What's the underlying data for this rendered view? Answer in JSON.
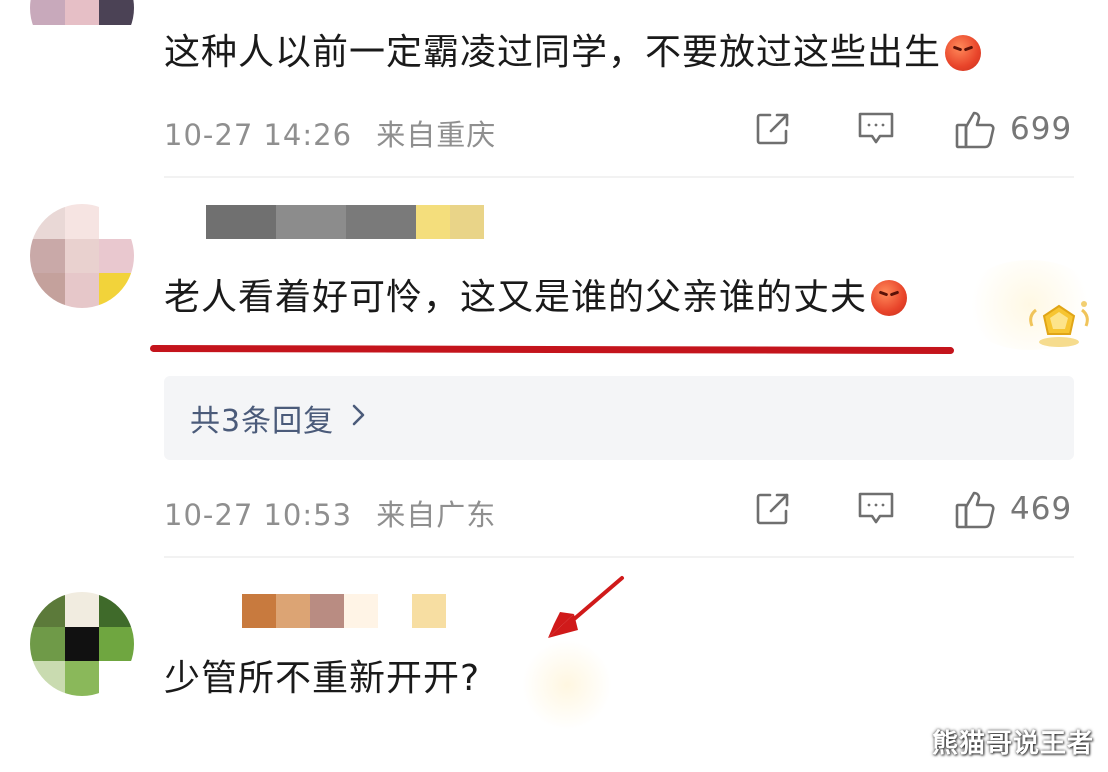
{
  "comments": [
    {
      "text": "这种人以前一定霸凌过同学，不要放过这些出生",
      "emoji": "angry-face-emoji",
      "date": "10-27 14:26",
      "location": "来自重庆",
      "likes": "699"
    },
    {
      "text": "老人看着好可怜，这又是谁的父亲谁的丈夫",
      "emoji": "angry-face-emoji",
      "replies_label": "共3条回复",
      "date": "10-27 10:53",
      "location": "来自广东",
      "likes": "469"
    },
    {
      "text": "少管所不重新开开?"
    }
  ],
  "colors": {
    "underline": "#c4141c",
    "arrow": "#d01a1a",
    "meta_text": "#8f8f8f",
    "replies_text": "#4b5b7a",
    "replies_bg": "#f4f5f7"
  },
  "icons": [
    "share-icon",
    "comment-icon",
    "thumbs-up-icon",
    "chevron-right-icon",
    "badge-icon"
  ],
  "watermark": "熊猫哥说王者"
}
